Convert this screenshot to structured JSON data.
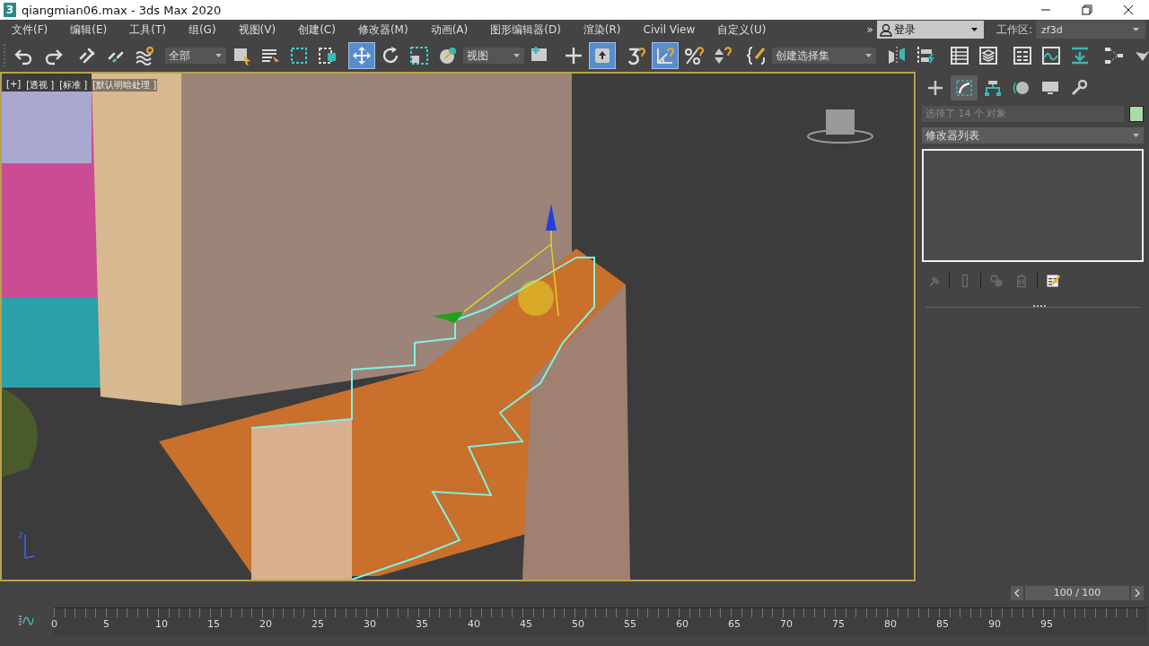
{
  "window": {
    "app_icon_text": "3",
    "title": "qiangmian06.max - 3ds Max 2020"
  },
  "menu": {
    "items": [
      "文件(F)",
      "编辑(E)",
      "工具(T)",
      "组(G)",
      "视图(V)",
      "创建(C)",
      "修改器(M)",
      "动画(A)",
      "图形编辑器(D)",
      "渲染(R)",
      "Civil View",
      "自定义(U)"
    ],
    "more": "»",
    "login": "登录",
    "workspace_label": "工作区:",
    "workspace_value": "zf3d"
  },
  "toolbar": [
    {
      "kind": "button",
      "selected": false
    },
    {
      "kind": "button",
      "selected": false
    },
    {
      "kind": "separator"
    },
    {
      "kind": "button",
      "selected": false
    },
    {
      "kind": "button",
      "selected": false
    },
    {
      "kind": "button",
      "selected": false
    },
    {
      "kind": "separator"
    },
    {
      "kind": "dropdown",
      "value": "全部"
    },
    {
      "kind": "button",
      "selected": false
    },
    {
      "kind": "button",
      "selected": false
    },
    {
      "kind": "button",
      "selected": false
    },
    {
      "kind": "button",
      "selected": false
    },
    {
      "kind": "separator"
    },
    {
      "kind": "button",
      "selected": true
    },
    {
      "kind": "button",
      "selected": false
    },
    {
      "kind": "button",
      "selected": false
    },
    {
      "kind": "button",
      "selected": false
    },
    {
      "kind": "dropdown",
      "value": "视图"
    },
    {
      "kind": "button",
      "selected": false
    },
    {
      "kind": "separator"
    },
    {
      "kind": "button",
      "selected": false
    },
    {
      "kind": "button",
      "selected": true
    },
    {
      "kind": "separator"
    },
    {
      "kind": "button",
      "selected": false
    },
    {
      "kind": "button",
      "selected": true
    },
    {
      "kind": "button",
      "selected": false
    },
    {
      "kind": "button",
      "selected": false
    },
    {
      "kind": "separator"
    },
    {
      "kind": "button",
      "selected": false
    },
    {
      "kind": "dropdown",
      "value": "创建选择集"
    },
    {
      "kind": "separator"
    },
    {
      "kind": "button",
      "selected": false
    },
    {
      "kind": "button",
      "selected": false
    },
    {
      "kind": "separator"
    },
    {
      "kind": "button",
      "selected": false
    },
    {
      "kind": "button",
      "selected": false
    },
    {
      "kind": "separator"
    },
    {
      "kind": "button",
      "selected": false
    },
    {
      "kind": "button",
      "selected": false
    },
    {
      "kind": "button",
      "selected": false
    },
    {
      "kind": "separator"
    },
    {
      "kind": "button",
      "selected": false
    },
    {
      "kind": "button",
      "selected": false
    }
  ],
  "viewport": {
    "labels": [
      "[+]",
      "[透视 ]",
      "[标准 ]",
      "[默认明暗处理 ]"
    ]
  },
  "command_panel": {
    "tabs": [
      {
        "selected": false
      },
      {
        "selected": true
      },
      {
        "selected": false
      },
      {
        "selected": false
      },
      {
        "selected": false
      },
      {
        "selected": false
      }
    ],
    "object_name": "选择了 14 个 对象",
    "swatch": {
      "color": "#a8dca8"
    },
    "modifier_list": "修改器列表",
    "stack_tools": [
      {
        "disabled": true
      },
      {
        "disabled": true
      },
      {
        "disabled": true
      },
      {
        "disabled": true
      },
      {
        "disabled": false
      }
    ]
  },
  "timeline": {
    "frame_counter": "100 / 100",
    "frame_labels": [
      "0",
      "5",
      "10",
      "15",
      "20",
      "25",
      "30",
      "35",
      "40",
      "45",
      "50",
      "55",
      "60",
      "65",
      "70",
      "75",
      "80",
      "85",
      "90",
      "95"
    ]
  }
}
